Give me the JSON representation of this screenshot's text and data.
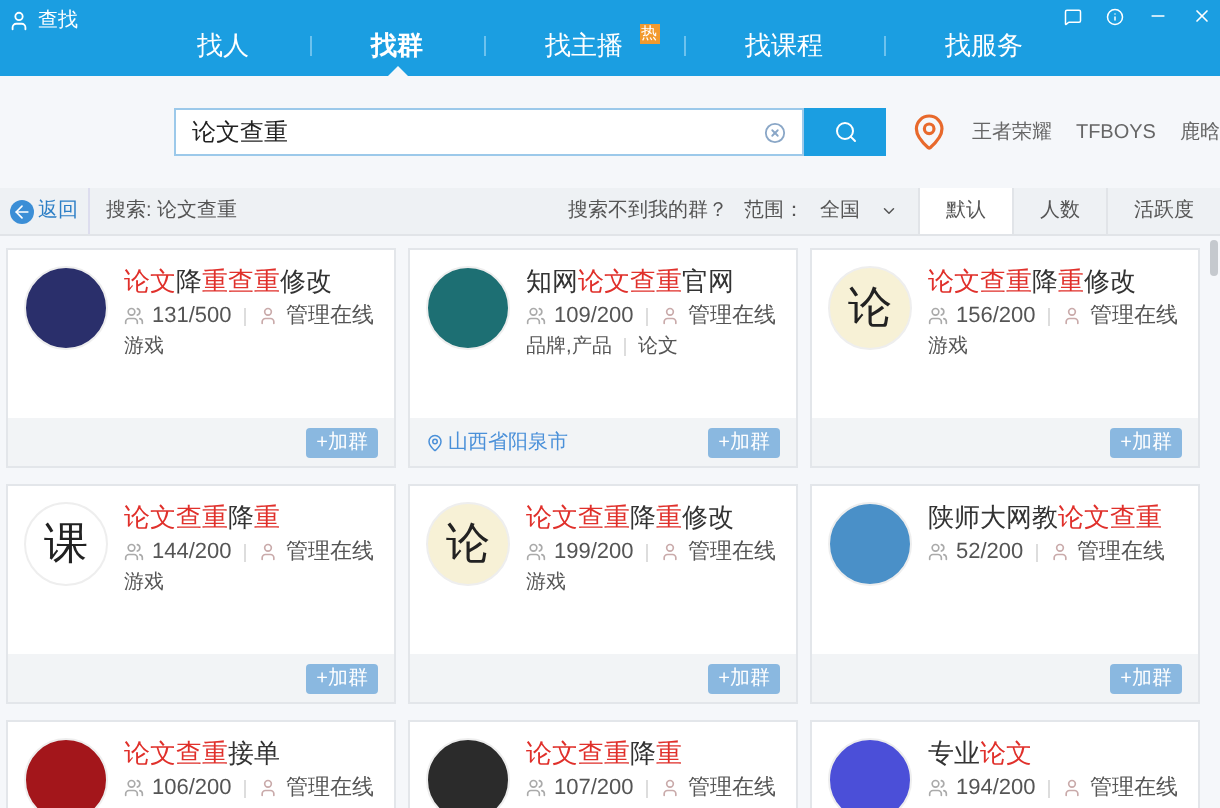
{
  "window": {
    "title": "查找"
  },
  "tabs": [
    {
      "label": "找人",
      "selected": false
    },
    {
      "label": "找群",
      "selected": true
    },
    {
      "label": "找主播",
      "selected": false,
      "badge": "热"
    },
    {
      "label": "找课程",
      "selected": false
    },
    {
      "label": "找服务",
      "selected": false
    }
  ],
  "search": {
    "value": "论文查重",
    "hot_words": [
      "王者荣耀",
      "TFBOYS",
      "鹿晗"
    ]
  },
  "filter_bar": {
    "back": "返回",
    "query": "搜索: 论文查重",
    "help": "搜索不到我的群？",
    "range_label": "范围：",
    "range_value": "全国",
    "sorts": [
      {
        "label": "默认",
        "selected": true
      },
      {
        "label": "人数",
        "selected": false
      },
      {
        "label": "活跃度",
        "selected": false
      }
    ]
  },
  "groups": [
    {
      "title": [
        {
          "text": "论文",
          "hit": true
        },
        {
          "text": "降",
          "hit": false
        },
        {
          "text": "重查重",
          "hit": true
        },
        {
          "text": "修改",
          "hit": false
        }
      ],
      "members": "131/500",
      "admin": "管理在线",
      "tags": [
        "游戏"
      ],
      "color": "#2a2f6b",
      "join": "+加群"
    },
    {
      "title": [
        {
          "text": "知网",
          "hit": false
        },
        {
          "text": "论文查重",
          "hit": true
        },
        {
          "text": "官网",
          "hit": false
        }
      ],
      "members": "109/200",
      "admin": "管理在线",
      "tags": [
        "品牌,产品",
        "论文"
      ],
      "location": "山西省阳泉市",
      "color": "#1d6f73",
      "join": "+加群"
    },
    {
      "title": [
        {
          "text": "论文查重",
          "hit": true
        },
        {
          "text": "降",
          "hit": false
        },
        {
          "text": "重",
          "hit": true
        },
        {
          "text": "修改",
          "hit": false
        }
      ],
      "members": "156/200",
      "admin": "管理在线",
      "tags": [
        "游戏"
      ],
      "color": "#f7f1d6",
      "avatar_text": "论",
      "join": "+加群"
    },
    {
      "title": [
        {
          "text": "论文查重",
          "hit": true
        },
        {
          "text": "降",
          "hit": false
        },
        {
          "text": "重",
          "hit": true
        }
      ],
      "members": "144/200",
      "admin": "管理在线",
      "tags": [
        "游戏"
      ],
      "color": "#ffffff",
      "avatar_text": "课",
      "join": "+加群"
    },
    {
      "title": [
        {
          "text": "论文查重",
          "hit": true
        },
        {
          "text": "降",
          "hit": false
        },
        {
          "text": "重",
          "hit": true
        },
        {
          "text": "修改",
          "hit": false
        }
      ],
      "members": "199/200",
      "admin": "管理在线",
      "tags": [
        "游戏"
      ],
      "color": "#f7f1d6",
      "avatar_text": "论",
      "join": "+加群"
    },
    {
      "title": [
        {
          "text": "陕师大网教",
          "hit": false
        },
        {
          "text": "论文查重",
          "hit": true
        }
      ],
      "members": "52/200",
      "admin": "管理在线",
      "color": "#4a90c8",
      "join": "+加群"
    },
    {
      "title": [
        {
          "text": "论文查重",
          "hit": true
        },
        {
          "text": "接单",
          "hit": false
        }
      ],
      "members": "106/200",
      "admin": "管理在线",
      "color": "#a3161b"
    },
    {
      "title": [
        {
          "text": "论文查重",
          "hit": true
        },
        {
          "text": "降",
          "hit": false
        },
        {
          "text": "重",
          "hit": true
        }
      ],
      "members": "107/200",
      "admin": "管理在线",
      "color": "#2b2b2b"
    },
    {
      "title": [
        {
          "text": "专业",
          "hit": false
        },
        {
          "text": "论文",
          "hit": true
        }
      ],
      "members": "194/200",
      "admin": "管理在线",
      "color": "#4b4fd8"
    }
  ]
}
